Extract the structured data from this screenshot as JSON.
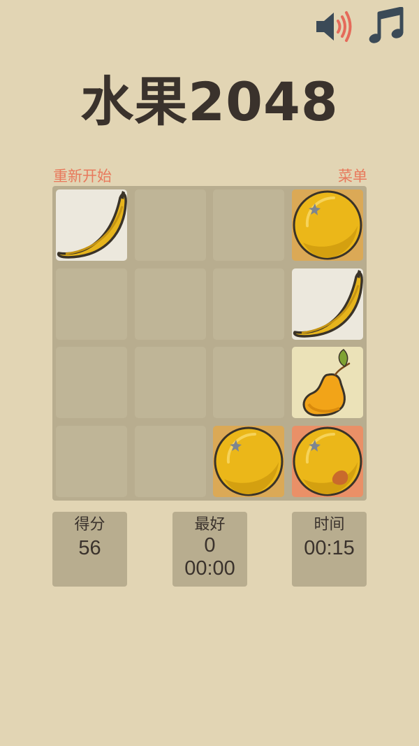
{
  "header": {
    "title": "水果2048",
    "icons": [
      "speaker-volume-icon",
      "music-note-icon"
    ]
  },
  "controls": {
    "restart_label": "重新开始",
    "menu_label": "菜单"
  },
  "board": {
    "size": 4,
    "tiles": [
      [
        "banana",
        "",
        "",
        "orange"
      ],
      [
        "",
        "",
        "",
        "banana"
      ],
      [
        "",
        "",
        "",
        "pear"
      ],
      [
        "",
        "",
        "orange",
        "peach-orange"
      ]
    ]
  },
  "stats": {
    "score_label": "得分",
    "score_value": "56",
    "best_label": "最好",
    "best_score": "0",
    "best_time": "00:00",
    "time_label": "时间",
    "time_value": "00:15"
  },
  "colors": {
    "background": "#e2d5b4",
    "board": "#b8ad8f",
    "empty_cell": "#bfb597",
    "accent_link": "#e8795c",
    "title": "#3a322c",
    "banana_tile": "#ece8dd",
    "orange_tile": "#dba956",
    "pear_tile": "#ebe2b8",
    "peach_tile": "#ea9067"
  }
}
